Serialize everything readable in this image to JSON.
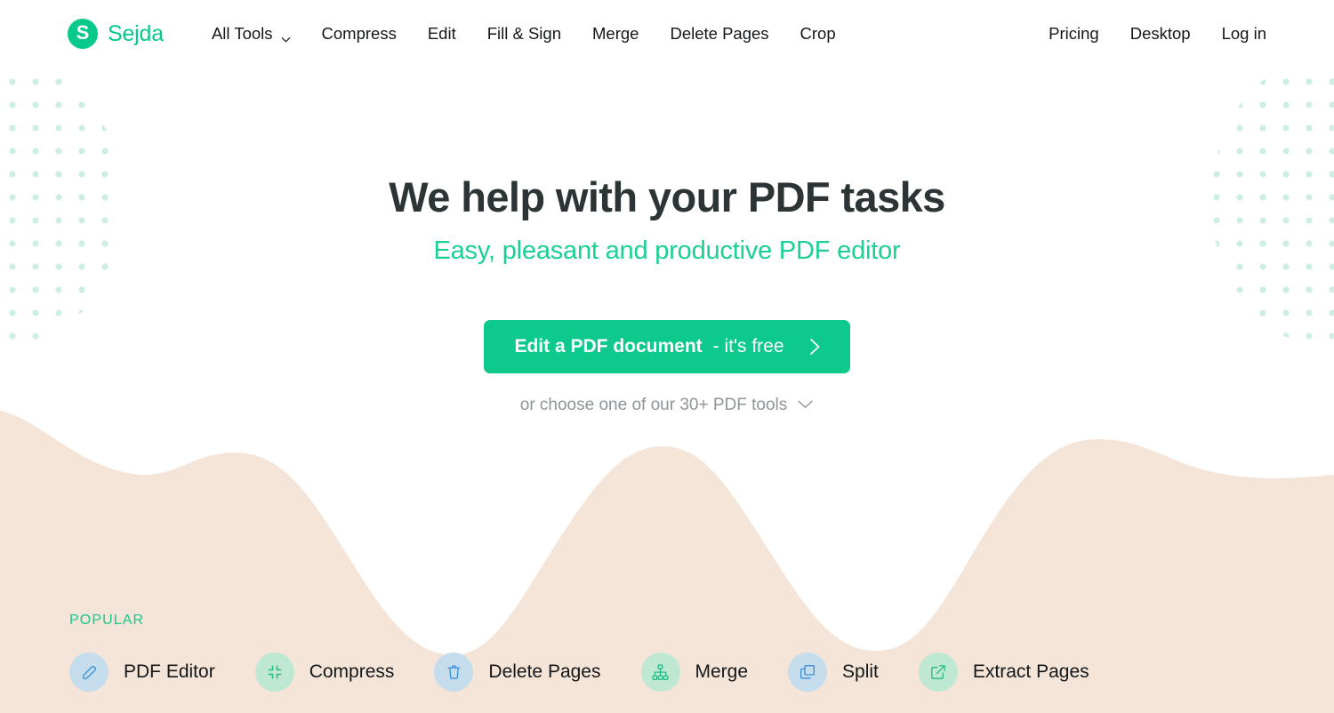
{
  "brand": {
    "mark_letter": "S",
    "name": "Sejda",
    "accent": "#07c98b"
  },
  "nav": {
    "left_items": [
      {
        "label": "All Tools",
        "has_caret": true
      },
      {
        "label": "Compress",
        "has_caret": false
      },
      {
        "label": "Edit",
        "has_caret": false
      },
      {
        "label": "Fill & Sign",
        "has_caret": false
      },
      {
        "label": "Merge",
        "has_caret": false
      },
      {
        "label": "Delete Pages",
        "has_caret": false
      },
      {
        "label": "Crop",
        "has_caret": false
      }
    ],
    "right_items": [
      {
        "label": "Pricing"
      },
      {
        "label": "Desktop"
      },
      {
        "label": "Log in"
      }
    ]
  },
  "hero": {
    "title": "We help with your PDF tasks",
    "subtitle": "Easy, pleasant and productive PDF editor",
    "subtitle_color": "#1ccf95",
    "cta": {
      "strong_text": "Edit a PDF document",
      "light_text": "- it's free",
      "icon": "chevron-right-icon",
      "background": "#0ec98c"
    },
    "secondary_link": {
      "text": "or choose one of our 30+ PDF tools",
      "icon": "chevron-down-icon"
    }
  },
  "popular": {
    "label": "POPULAR",
    "label_color": "#17c98d",
    "tools": [
      {
        "label": "PDF Editor",
        "icon": "pencil-icon",
        "tone": "blue"
      },
      {
        "label": "Compress",
        "icon": "compress-icon",
        "tone": "green"
      },
      {
        "label": "Delete Pages",
        "icon": "trash-icon",
        "tone": "blue"
      },
      {
        "label": "Merge",
        "icon": "sitemap-icon",
        "tone": "green"
      },
      {
        "label": "Split",
        "icon": "layers-icon",
        "tone": "blue"
      },
      {
        "label": "Extract Pages",
        "icon": "external-link-icon",
        "tone": "green"
      }
    ]
  },
  "theme": {
    "page_background": "#ffffff",
    "wave_fill": "#f4e5d8",
    "dot_color": "#cdeee2",
    "icon_blue": "#3b8fd4",
    "icon_green": "#2bb98a"
  }
}
